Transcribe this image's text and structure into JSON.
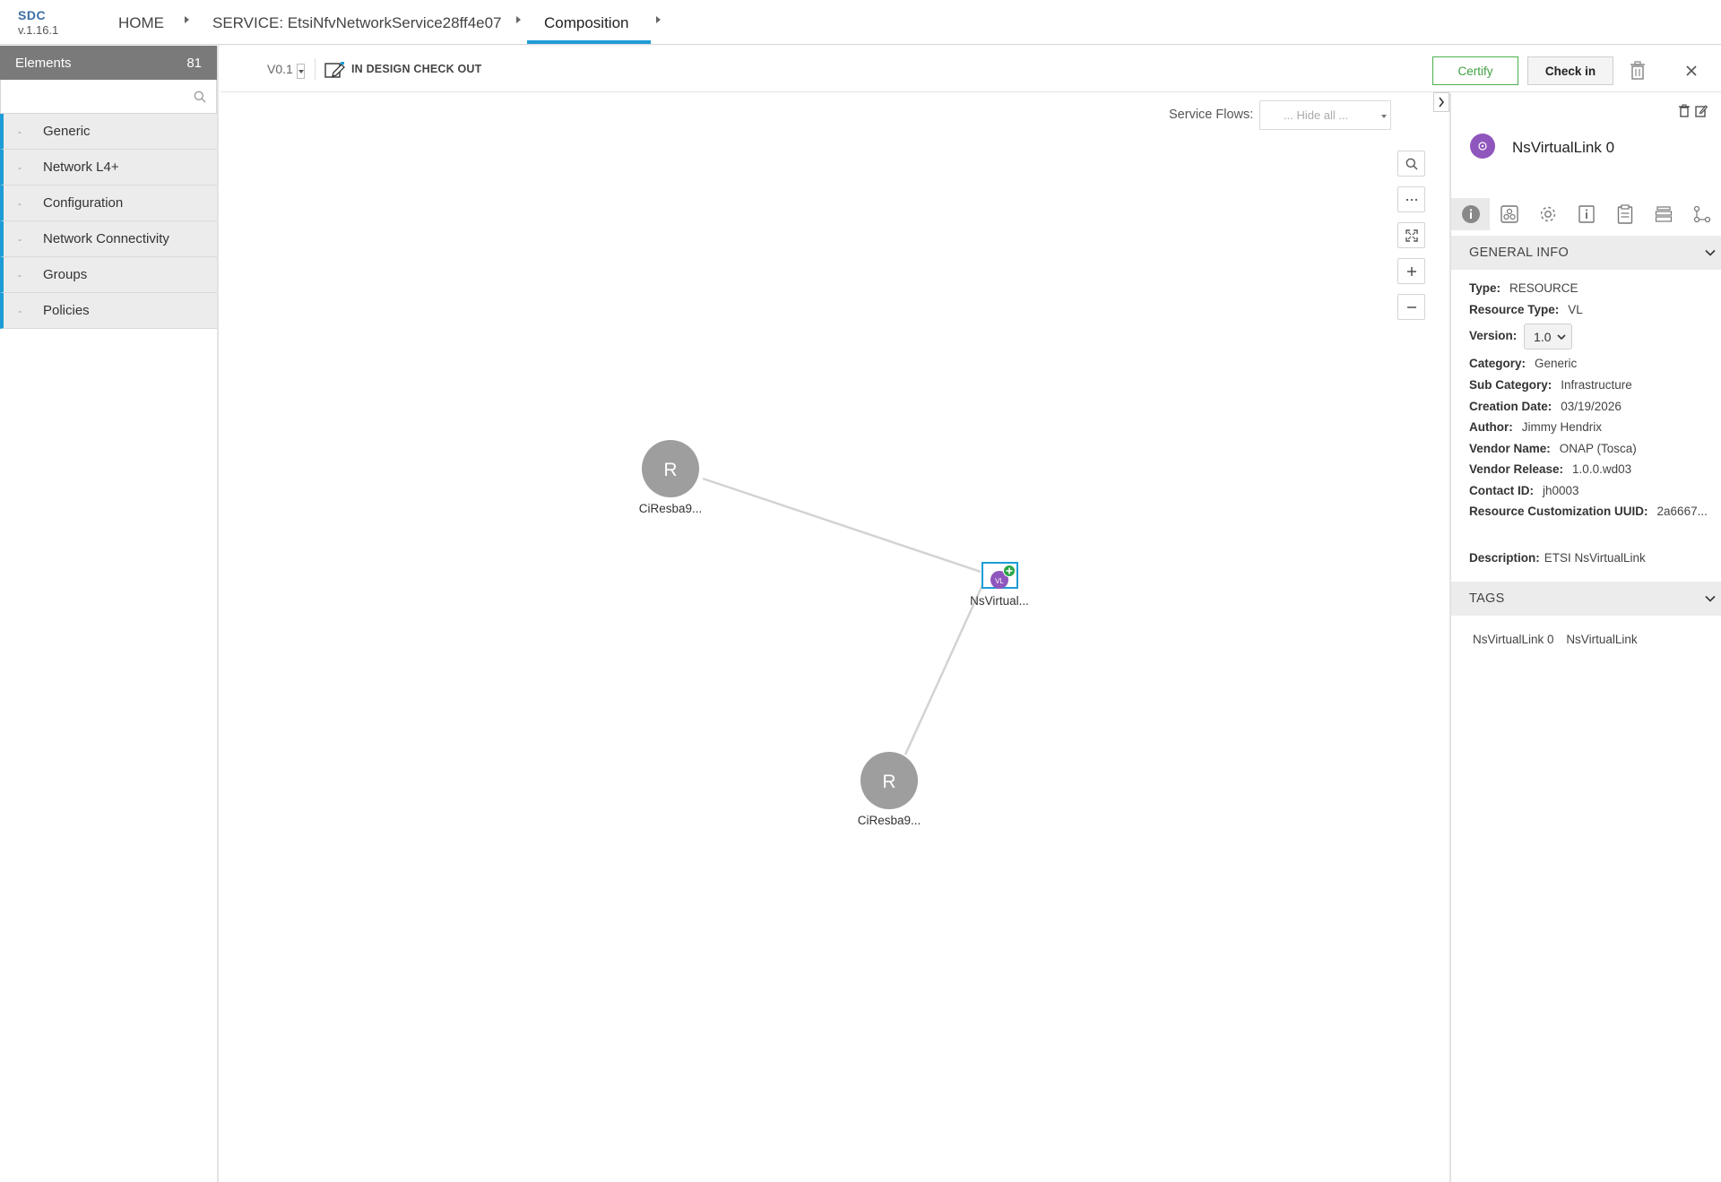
{
  "header": {
    "logo_name": "SDC",
    "logo_version": "v.1.16.1",
    "breadcrumbs": [
      "HOME",
      "SERVICE: EtsiNfvNetworkService28ff4e07",
      "Composition"
    ]
  },
  "sidebar": {
    "title": "Elements",
    "count": "81",
    "search_placeholder": "",
    "categories": [
      {
        "dash": "-",
        "label": "Generic"
      },
      {
        "dash": "-",
        "label": "Network L4+"
      },
      {
        "dash": "-",
        "label": "Configuration"
      },
      {
        "dash": "-",
        "label": "Network Connectivity"
      },
      {
        "dash": "-",
        "label": "Groups"
      },
      {
        "dash": "-",
        "label": "Policies"
      }
    ]
  },
  "toolbar": {
    "version": "V0.1",
    "status": "IN DESIGN CHECK OUT",
    "certify": "Certify",
    "checkin": "Check in"
  },
  "canvas": {
    "service_flows_label": "Service Flows:",
    "service_flows_value": "... Hide all ...",
    "nodes": [
      {
        "letter": "R",
        "label": "CiResba9..."
      },
      {
        "letter": "VL",
        "label": "NsVirtual..."
      },
      {
        "letter": "R",
        "label": "CiResba9..."
      }
    ]
  },
  "panel": {
    "title": "NsVirtualLink 0",
    "general_info_title": "GENERAL INFO",
    "info": {
      "type_label": "Type:",
      "type": "RESOURCE",
      "resource_type_label": "Resource Type:",
      "resource_type": "VL",
      "version_label": "Version:",
      "version": "1.0",
      "category_label": "Category:",
      "category": "Generic",
      "subcategory_label": "Sub Category:",
      "subcategory": "Infrastructure",
      "creation_date_label": "Creation Date:",
      "creation_date": "03/19/2026",
      "author_label": "Author:",
      "author": "Jimmy Hendrix",
      "vendor_name_label": "Vendor Name:",
      "vendor_name": "ONAP (Tosca)",
      "vendor_release_label": "Vendor Release:",
      "vendor_release": "1.0.0.wd03",
      "contact_id_label": "Contact ID:",
      "contact_id": "jh0003",
      "uuid_label": "Resource Customization UUID:",
      "uuid": "2a6667...",
      "description_label": "Description:",
      "description": "ETSI NsVirtualLink"
    },
    "tags_title": "TAGS",
    "tags": [
      "NsVirtualLink 0",
      "NsVirtualLink"
    ]
  },
  "colors": {
    "accent": "#1e9cd7",
    "certify": "#4caf50",
    "node_gray": "#9e9e9e",
    "vl_purple": "#8f56bd"
  }
}
